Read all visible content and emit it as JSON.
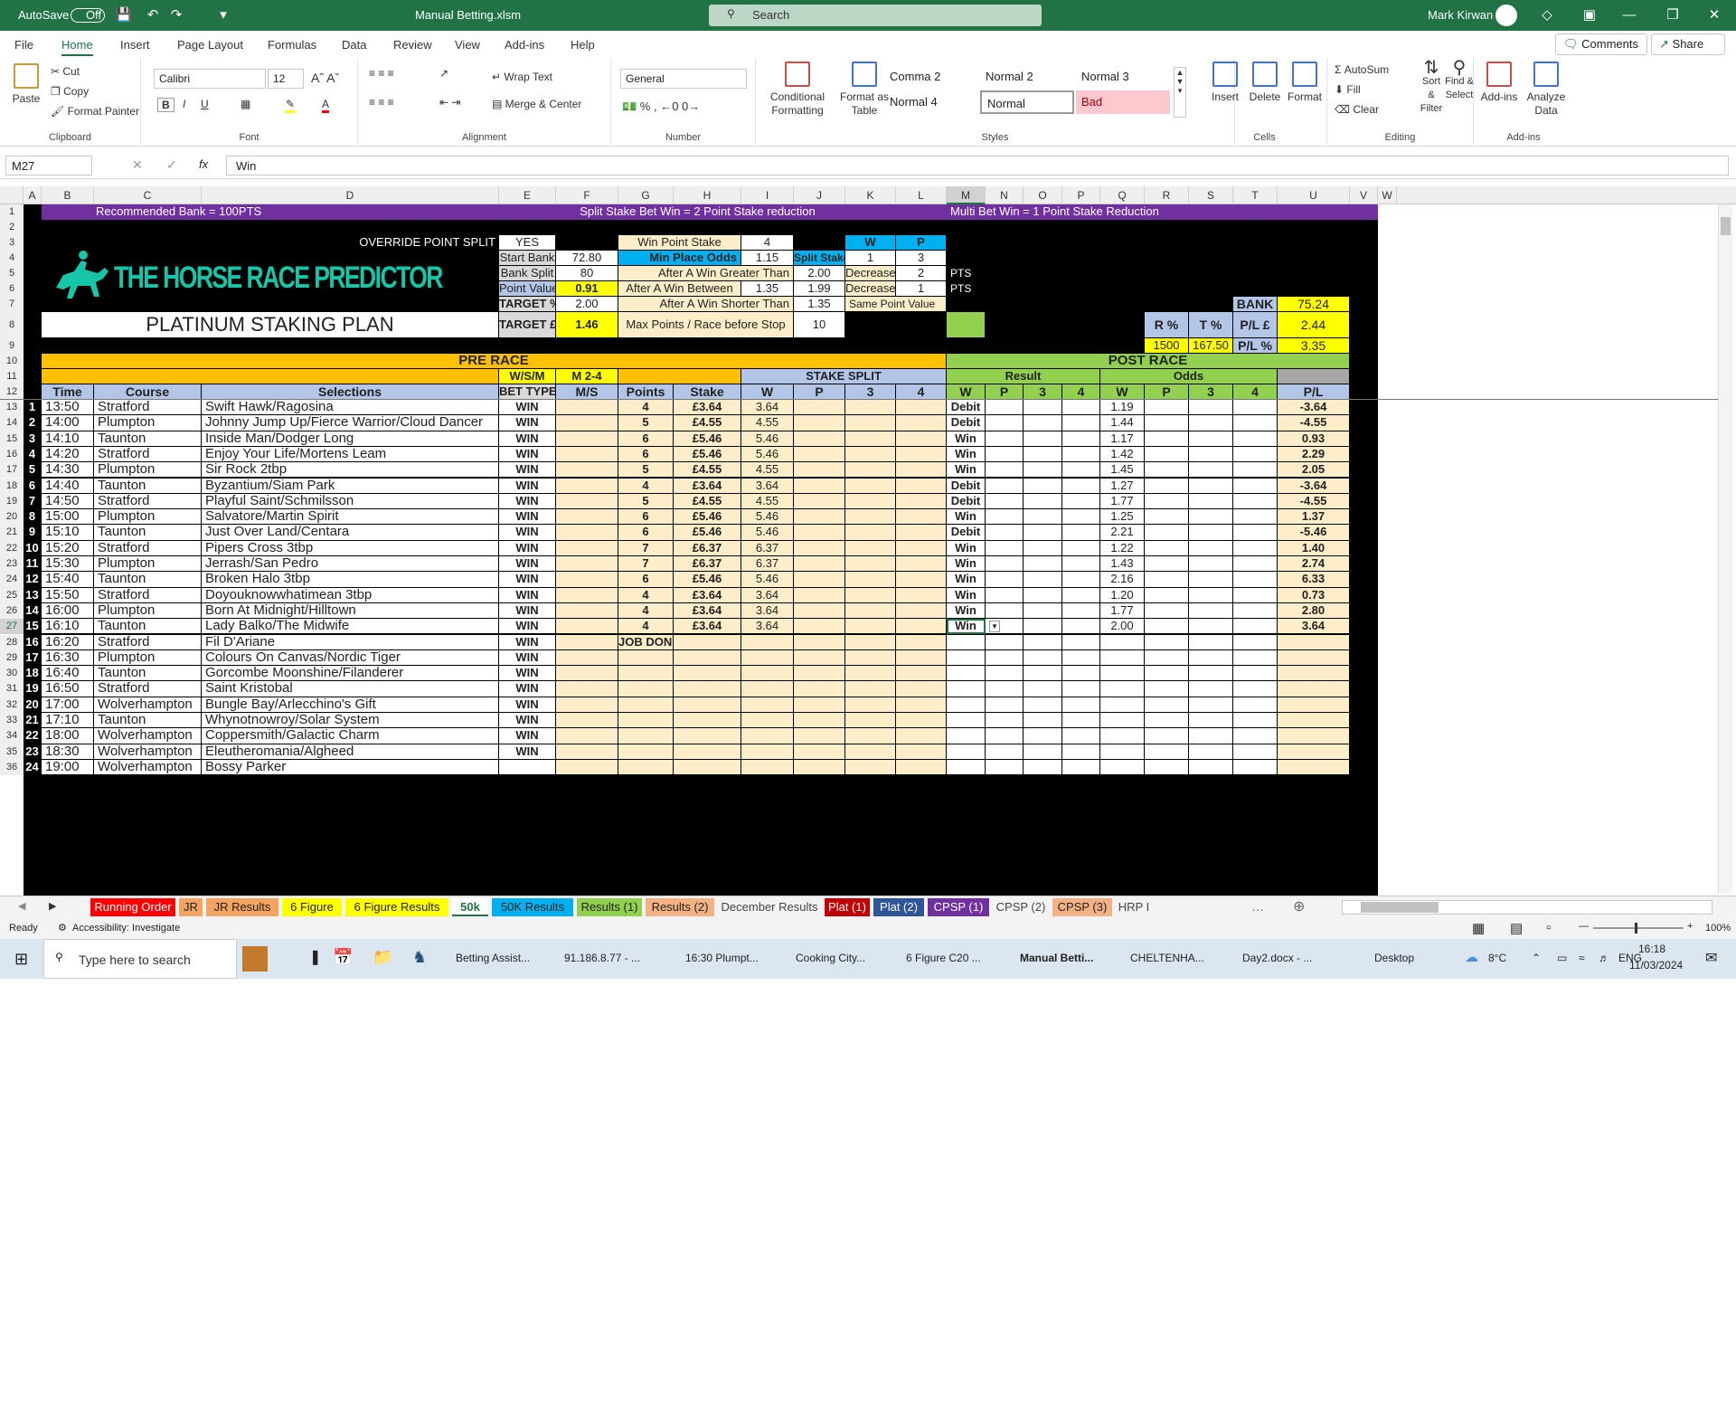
{
  "titlebar": {
    "autosave": "AutoSave",
    "autosave_state": "Off",
    "filename": "Manual Betting.xlsm",
    "search": "Search",
    "user": "Mark Kirwan"
  },
  "menu": [
    "File",
    "Home",
    "Insert",
    "Page Layout",
    "Formulas",
    "Data",
    "Review",
    "View",
    "Add-ins",
    "Help"
  ],
  "comments": "Comments",
  "share": "Share",
  "ribbon": {
    "paste": "Paste",
    "cut": "Cut",
    "copy": "Copy",
    "format_painter": "Format Painter",
    "clipboard": "Clipboard",
    "font_name": "Calibri",
    "font_size": "12",
    "font": "Font",
    "wrap": "Wrap Text",
    "merge": "Merge & Center",
    "alignment": "Alignment",
    "numfmt": "General",
    "number": "Number",
    "cond": "Conditional Formatting",
    "fmt_table": "Format as Table",
    "styles": "Styles",
    "style_cells": [
      "Comma 2",
      "Normal 2",
      "Normal 3",
      "Normal 4",
      "Normal",
      "Bad"
    ],
    "insert": "Insert",
    "delete": "Delete",
    "format": "Format",
    "cells": "Cells",
    "autosum": "AutoSum",
    "fill": "Fill",
    "clear": "Clear",
    "sort": "Sort & Filter",
    "find": "Find & Select",
    "editing": "Editing",
    "addins": "Add-ins",
    "analyze": "Analyze Data",
    "addins_group": "Add-ins"
  },
  "formula": {
    "namebox": "M27",
    "value": "Win"
  },
  "columns": [
    "A",
    "B",
    "C",
    "D",
    "E",
    "F",
    "G",
    "H",
    "I",
    "J",
    "K",
    "L",
    "M",
    "N",
    "O",
    "P",
    "Q",
    "R",
    "S",
    "T",
    "U",
    "V",
    "W"
  ],
  "banner": {
    "left": "Recommended Bank = 100PTS",
    "mid": "Split Stake Bet Win = 2 Point Stake reduction",
    "right": "Multi Bet Win = 1 Point  Stake Reduction"
  },
  "settings": {
    "override_label": "OVERRIDE POINT SPLIT",
    "override_val": "YES",
    "start_bank_label": "Start Bank",
    "start_bank": "72.80",
    "bank_split_label": "Bank Split",
    "bank_split": "80",
    "point_value_label": "Point Value",
    "point_value": "0.91",
    "target_pct_label": "TARGET %",
    "target_pct": "2.00",
    "target_gbp_label": "TARGET £",
    "target_gbp": "1.46",
    "win_point_label": "Win Point Stake",
    "win_point": "4",
    "min_place_label": "Min Place Odds",
    "min_place": "1.15",
    "after_greater_label": "After A Win Greater Than",
    "after_greater": "2.00",
    "after_between_label": "After A Win Between",
    "between_lo": "1.35",
    "between_hi": "1.99",
    "after_shorter_label": "After A Win Shorter Than",
    "after_shorter": "1.35",
    "max_points_label": "Max Points / Race before Stop",
    "max_points": "10",
    "w": "W",
    "p": "P",
    "split_stake": "Split Stake",
    "split_w": "1",
    "split_p": "3",
    "decrease": "Decrease",
    "dec1": "2",
    "dec2": "1",
    "pts": "PTS",
    "same_point": "Same Point Value",
    "bank_label": "BANK",
    "bank": "75.24",
    "r_pct": "R %",
    "t_pct": "T %",
    "pl_gbp_label": "P/L  £",
    "pl_gbp": "2.44",
    "r_val": "1500",
    "t_val": "167.50",
    "pl_pct_label": "P/L %",
    "pl_pct": "3.35"
  },
  "logo": {
    "text": "THE HORSE RACE PREDICTOR",
    "plan": "PLATINUM STAKING PLAN"
  },
  "headers": {
    "pre_race": "PRE RACE",
    "post_race": "POST RACE",
    "wsm": "W/S/M",
    "m24": "M 2-4",
    "stake_split": "STAKE SPLIT",
    "result": "Result",
    "odds": "Odds",
    "time": "Time",
    "course": "Course",
    "selections": "Selections",
    "bet_type": "BET TYPE",
    "ms": "M/S",
    "points": "Points",
    "stake": "Stake",
    "w": "W",
    "p": "P",
    "three": "3",
    "four": "4",
    "pl": "P/L"
  },
  "rows": [
    {
      "r": "13",
      "n": "1",
      "time": "13:50",
      "course": "Stratford",
      "sel": "Swift Hawk/Ragosina",
      "bt": "WIN",
      "pts": "4",
      "stake": "£3.64",
      "sw": "3.64",
      "res": "Debit",
      "odds": "1.19",
      "pl": "-3.64"
    },
    {
      "r": "14",
      "n": "2",
      "time": "14:00",
      "course": "Plumpton",
      "sel": "Johnny Jump Up/Fierce Warrior/Cloud Dancer",
      "bt": "WIN",
      "pts": "5",
      "stake": "£4.55",
      "sw": "4.55",
      "res": "Debit",
      "odds": "1.44",
      "pl": "-4.55"
    },
    {
      "r": "15",
      "n": "3",
      "time": "14:10",
      "course": "Taunton",
      "sel": "Inside Man/Dodger Long",
      "bt": "WIN",
      "pts": "6",
      "stake": "£5.46",
      "sw": "5.46",
      "res": "Win",
      "odds": "1.17",
      "pl": "0.93"
    },
    {
      "r": "16",
      "n": "4",
      "time": "14:20",
      "course": "Stratford",
      "sel": "Enjoy Your Life/Mortens Leam",
      "bt": "WIN",
      "pts": "6",
      "stake": "£5.46",
      "sw": "5.46",
      "res": "Win",
      "odds": "1.42",
      "pl": "2.29"
    },
    {
      "r": "17",
      "n": "5",
      "time": "14:30",
      "course": "Plumpton",
      "sel": "Sir Rock 2tbp",
      "bt": "WIN",
      "pts": "5",
      "stake": "£4.55",
      "sw": "4.55",
      "res": "Win",
      "odds": "1.45",
      "pl": "2.05"
    },
    {
      "r": "18",
      "n": "6",
      "time": "14:40",
      "course": "Taunton",
      "sel": "Byzantium/Siam Park",
      "bt": "WIN",
      "pts": "4",
      "stake": "£3.64",
      "sw": "3.64",
      "res": "Debit",
      "odds": "1.27",
      "pl": "-3.64"
    },
    {
      "r": "19",
      "n": "7",
      "time": "14:50",
      "course": "Stratford",
      "sel": "Playful Saint/Schmilsson",
      "bt": "WIN",
      "pts": "5",
      "stake": "£4.55",
      "sw": "4.55",
      "res": "Debit",
      "odds": "1.77",
      "pl": "-4.55"
    },
    {
      "r": "20",
      "n": "8",
      "time": "15:00",
      "course": "Plumpton",
      "sel": "Salvatore/Martin Spirit",
      "bt": "WIN",
      "pts": "6",
      "stake": "£5.46",
      "sw": "5.46",
      "res": "Win",
      "odds": "1.25",
      "pl": "1.37"
    },
    {
      "r": "21",
      "n": "9",
      "time": "15:10",
      "course": "Taunton",
      "sel": "Just Over Land/Centara",
      "bt": "WIN",
      "pts": "6",
      "stake": "£5.46",
      "sw": "5.46",
      "res": "Debit",
      "odds": "2.21",
      "pl": "-5.46"
    },
    {
      "r": "22",
      "n": "10",
      "time": "15:20",
      "course": "Stratford",
      "sel": "Pipers Cross 3tbp",
      "bt": "WIN",
      "pts": "7",
      "stake": "£6.37",
      "sw": "6.37",
      "res": "Win",
      "odds": "1.22",
      "pl": "1.40"
    },
    {
      "r": "23",
      "n": "11",
      "time": "15:30",
      "course": "Plumpton",
      "sel": "Jerrash/San Pedro",
      "bt": "WIN",
      "pts": "7",
      "stake": "£6.37",
      "sw": "6.37",
      "res": "Win",
      "odds": "1.43",
      "pl": "2.74"
    },
    {
      "r": "24",
      "n": "12",
      "time": "15:40",
      "course": "Taunton",
      "sel": "Broken Halo 3tbp",
      "bt": "WIN",
      "pts": "6",
      "stake": "£5.46",
      "sw": "5.46",
      "res": "Win",
      "odds": "2.16",
      "pl": "6.33"
    },
    {
      "r": "25",
      "n": "13",
      "time": "15:50",
      "course": "Stratford",
      "sel": "Doyouknowwhatimean 3tbp",
      "bt": "WIN",
      "pts": "4",
      "stake": "£3.64",
      "sw": "3.64",
      "res": "Win",
      "odds": "1.20",
      "pl": "0.73"
    },
    {
      "r": "26",
      "n": "14",
      "time": "16:00",
      "course": "Plumpton",
      "sel": "Born At Midnight/Hilltown",
      "bt": "WIN",
      "pts": "4",
      "stake": "£3.64",
      "sw": "3.64",
      "res": "Win",
      "odds": "1.77",
      "pl": "2.80"
    },
    {
      "r": "27",
      "n": "15",
      "time": "16:10",
      "course": "Taunton",
      "sel": "Lady Balko/The Midwife",
      "bt": "WIN",
      "pts": "4",
      "stake": "£3.64",
      "sw": "3.64",
      "res": "Win",
      "odds": "2.00",
      "pl": "3.64"
    },
    {
      "r": "28",
      "n": "16",
      "time": "16:20",
      "course": "Stratford",
      "sel": "Fil D'Ariane",
      "bt": "WIN",
      "pts": "JOB DONE",
      "stake": "",
      "sw": "",
      "res": "",
      "odds": "",
      "pl": ""
    },
    {
      "r": "29",
      "n": "17",
      "time": "16:30",
      "course": "Plumpton",
      "sel": "Colours On Canvas/Nordic Tiger",
      "bt": "WIN",
      "pts": "",
      "stake": "",
      "sw": "",
      "res": "",
      "odds": "",
      "pl": ""
    },
    {
      "r": "30",
      "n": "18",
      "time": "16:40",
      "course": "Taunton",
      "sel": "Gorcombe Moonshine/Filanderer",
      "bt": "WIN",
      "pts": "",
      "stake": "",
      "sw": "",
      "res": "",
      "odds": "",
      "pl": ""
    },
    {
      "r": "31",
      "n": "19",
      "time": "16:50",
      "course": "Stratford",
      "sel": "Saint Kristobal",
      "bt": "WIN",
      "pts": "",
      "stake": "",
      "sw": "",
      "res": "",
      "odds": "",
      "pl": ""
    },
    {
      "r": "32",
      "n": "20",
      "time": "17:00",
      "course": "Wolverhampton",
      "sel": "Bungle Bay/Arlecchino's Gift",
      "bt": "WIN",
      "pts": "",
      "stake": "",
      "sw": "",
      "res": "",
      "odds": "",
      "pl": ""
    },
    {
      "r": "33",
      "n": "21",
      "time": "17:10",
      "course": "Taunton",
      "sel": "Whynotnowroy/Solar System",
      "bt": "WIN",
      "pts": "",
      "stake": "",
      "sw": "",
      "res": "",
      "odds": "",
      "pl": ""
    },
    {
      "r": "34",
      "n": "22",
      "time": "18:00",
      "course": "Wolverhampton",
      "sel": "Coppersmith/Galactic Charm",
      "bt": "WIN",
      "pts": "",
      "stake": "",
      "sw": "",
      "res": "",
      "odds": "",
      "pl": ""
    },
    {
      "r": "35",
      "n": "23",
      "time": "18:30",
      "course": "Wolverhampton",
      "sel": "Eleutheromania/Algheed",
      "bt": "WIN",
      "pts": "",
      "stake": "",
      "sw": "",
      "res": "",
      "odds": "",
      "pl": ""
    },
    {
      "r": "36",
      "n": "24",
      "time": "19:00",
      "course": "Wolverhampton",
      "sel": "Bossy Parker",
      "bt": "",
      "pts": "",
      "stake": "",
      "sw": "",
      "res": "",
      "odds": "",
      "pl": ""
    }
  ],
  "sheet_tabs": [
    {
      "name": "Running Order",
      "bg": "#ff0000",
      "fg": "#ffffff"
    },
    {
      "name": "JR",
      "bg": "#f4a460",
      "fg": "#222222"
    },
    {
      "name": "JR Results",
      "bg": "#f4a460",
      "fg": "#222222"
    },
    {
      "name": "6 Figure",
      "bg": "#ffff00",
      "fg": "#222222"
    },
    {
      "name": "6 Figure Results",
      "bg": "#ffff00",
      "fg": "#222222"
    },
    {
      "name": "50k",
      "bg": "#ffffff",
      "fg": "#217346"
    },
    {
      "name": "50K Results",
      "bg": "#00b0f0",
      "fg": "#222222"
    },
    {
      "name": "Results (1)",
      "bg": "#92d050",
      "fg": "#222222"
    },
    {
      "name": "Results (2)",
      "bg": "#f4b183",
      "fg": "#222222"
    },
    {
      "name": "December Results",
      "bg": "#f3f3f3",
      "fg": "#444444"
    },
    {
      "name": "Plat (1)",
      "bg": "#c00000",
      "fg": "#ffffff"
    },
    {
      "name": "Plat (2)",
      "bg": "#2f5597",
      "fg": "#ffffff"
    },
    {
      "name": "CPSP (1)",
      "bg": "#7030a0",
      "fg": "#ffffff"
    },
    {
      "name": "CPSP (2)",
      "bg": "#f3f3f3",
      "fg": "#444444"
    },
    {
      "name": "CPSP (3)",
      "bg": "#f4b183",
      "fg": "#222222"
    },
    {
      "name": "HRP I",
      "bg": "#f3f3f3",
      "fg": "#444444"
    }
  ],
  "status": {
    "ready": "Ready",
    "accessibility": "Accessibility: Investigate",
    "zoom": "100%"
  },
  "taskbar": {
    "search": "Type here to search",
    "items": [
      "Betting Assist...",
      "91.186.8.77 - ...",
      "16:30 Plumpt...",
      "Cooking City...",
      "6 Figure C20 ...",
      "Manual Betti...",
      "CHELTENHA...",
      "Day2.docx - ..."
    ],
    "desktop": "Desktop",
    "temp": "8°C",
    "lang": "ENG",
    "time": "16:18",
    "date": "11/03/2024"
  }
}
